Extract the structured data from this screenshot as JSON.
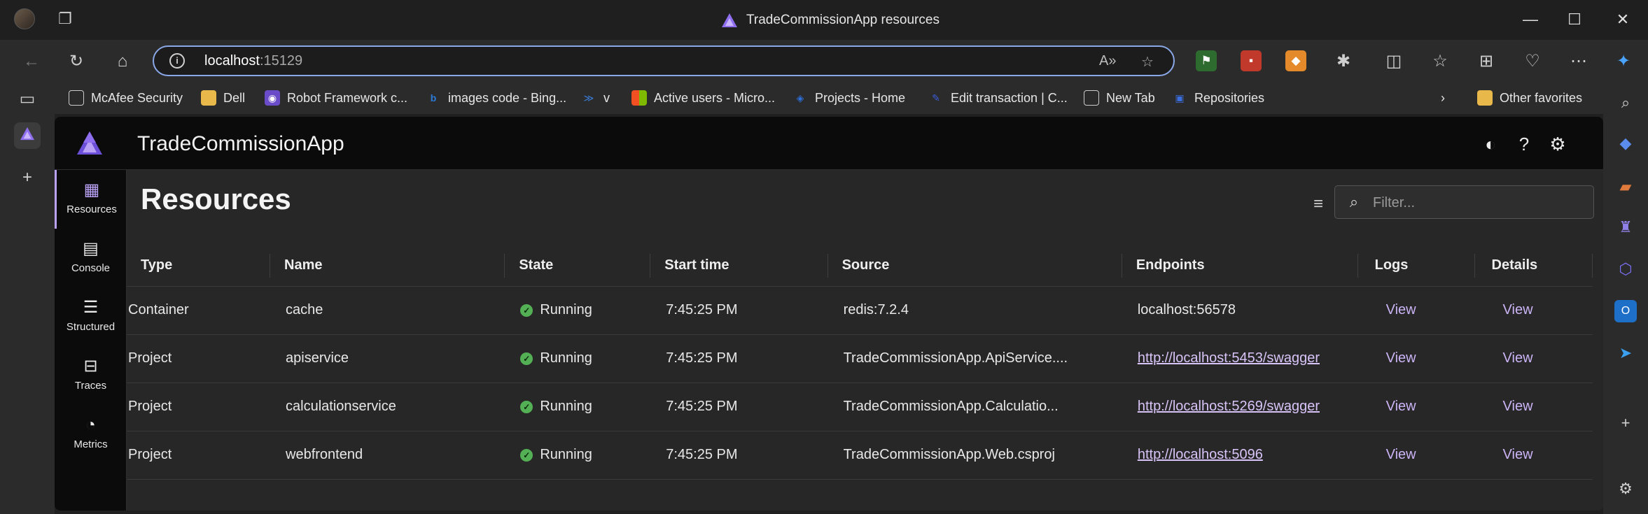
{
  "browser": {
    "window_title": "TradeCommissionApp resources",
    "url_host": "localhost",
    "url_port": ":15129",
    "favorites": [
      {
        "label": "McAfee Security",
        "color": "#2b2b2b",
        "icon": "page-icon"
      },
      {
        "label": "Dell",
        "color": "#e8b84a",
        "icon": "folder-icon"
      },
      {
        "label": "Robot Framework c...",
        "color": "#6a4bc8",
        "icon": "robot-icon"
      },
      {
        "label": "images code - Bing...",
        "color": "#2b7bd6",
        "icon": "bing-icon"
      },
      {
        "label": "v",
        "color": "#3a7bd5",
        "icon": "jira-icon"
      },
      {
        "label": "Active users - Micro...",
        "color": "#f25022",
        "icon": "microsoft-icon"
      },
      {
        "label": "Projects - Home",
        "color": "#2d6fd8",
        "icon": "azure-devops-icon"
      },
      {
        "label": "Edit transaction | C...",
        "color": "#3b5bdb",
        "icon": "edit-icon"
      },
      {
        "label": "New Tab",
        "color": "#2b2b2b",
        "icon": "page-icon"
      },
      {
        "label": "Repositories",
        "color": "#3b6fe0",
        "icon": "repo-icon"
      }
    ],
    "other_favorites": "Other favorites"
  },
  "app": {
    "title": "TradeCommissionApp",
    "accent": "#b9a1f5",
    "nav": [
      {
        "label": "Resources",
        "icon": "resources-icon"
      },
      {
        "label": "Console",
        "icon": "console-icon"
      },
      {
        "label": "Structured",
        "icon": "structured-icon"
      },
      {
        "label": "Traces",
        "icon": "traces-icon"
      },
      {
        "label": "Metrics",
        "icon": "metrics-icon"
      }
    ]
  },
  "resources": {
    "page_title": "Resources",
    "filter_placeholder": "Filter...",
    "columns": [
      "Type",
      "Name",
      "State",
      "Start time",
      "Source",
      "Endpoints",
      "Logs",
      "Details"
    ],
    "rows": [
      {
        "type": "Container",
        "name": "cache",
        "state": "Running",
        "start_time": "7:45:25 PM",
        "source": "redis:7.2.4",
        "endpoint": "localhost:56578",
        "endpoint_is_link": false,
        "logs": "View",
        "details": "View"
      },
      {
        "type": "Project",
        "name": "apiservice",
        "state": "Running",
        "start_time": "7:45:25 PM",
        "source": "TradeCommissionApp.ApiService....",
        "endpoint": "http://localhost:5453/swagger",
        "endpoint_is_link": true,
        "logs": "View",
        "details": "View"
      },
      {
        "type": "Project",
        "name": "calculationservice",
        "state": "Running",
        "start_time": "7:45:25 PM",
        "source": "TradeCommissionApp.Calculatio...",
        "endpoint": "http://localhost:5269/swagger",
        "endpoint_is_link": true,
        "logs": "View",
        "details": "View"
      },
      {
        "type": "Project",
        "name": "webfrontend",
        "state": "Running",
        "start_time": "7:45:25 PM",
        "source": "TradeCommissionApp.Web.csproj",
        "endpoint": "http://localhost:5096",
        "endpoint_is_link": true,
        "logs": "View",
        "details": "View"
      }
    ],
    "status_color": "#54b054"
  }
}
